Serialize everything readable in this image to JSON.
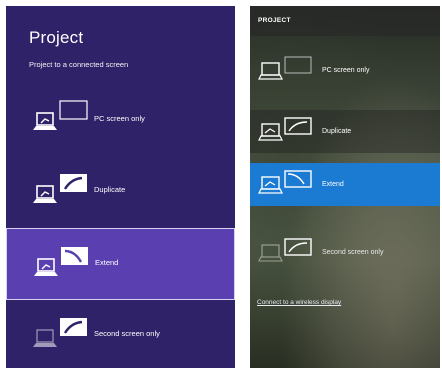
{
  "left": {
    "title": "Project",
    "subtitle": "Project to a connected screen",
    "options": [
      {
        "label": "PC screen only"
      },
      {
        "label": "Duplicate"
      },
      {
        "label": "Extend"
      },
      {
        "label": "Second screen only"
      }
    ],
    "selected": "Extend"
  },
  "right": {
    "header": "PROJECT",
    "options": [
      {
        "label": "PC screen only"
      },
      {
        "label": "Duplicate"
      },
      {
        "label": "Extend"
      },
      {
        "label": "Second screen only"
      }
    ],
    "selected": "Extend",
    "wireless_link": "Connect to a wireless display"
  },
  "colors": {
    "left_background": "#2f2268",
    "left_selected": "#5a3fb0",
    "right_selected": "#1b7ad1"
  },
  "icons": [
    "laptop-icon",
    "monitor-icon"
  ]
}
